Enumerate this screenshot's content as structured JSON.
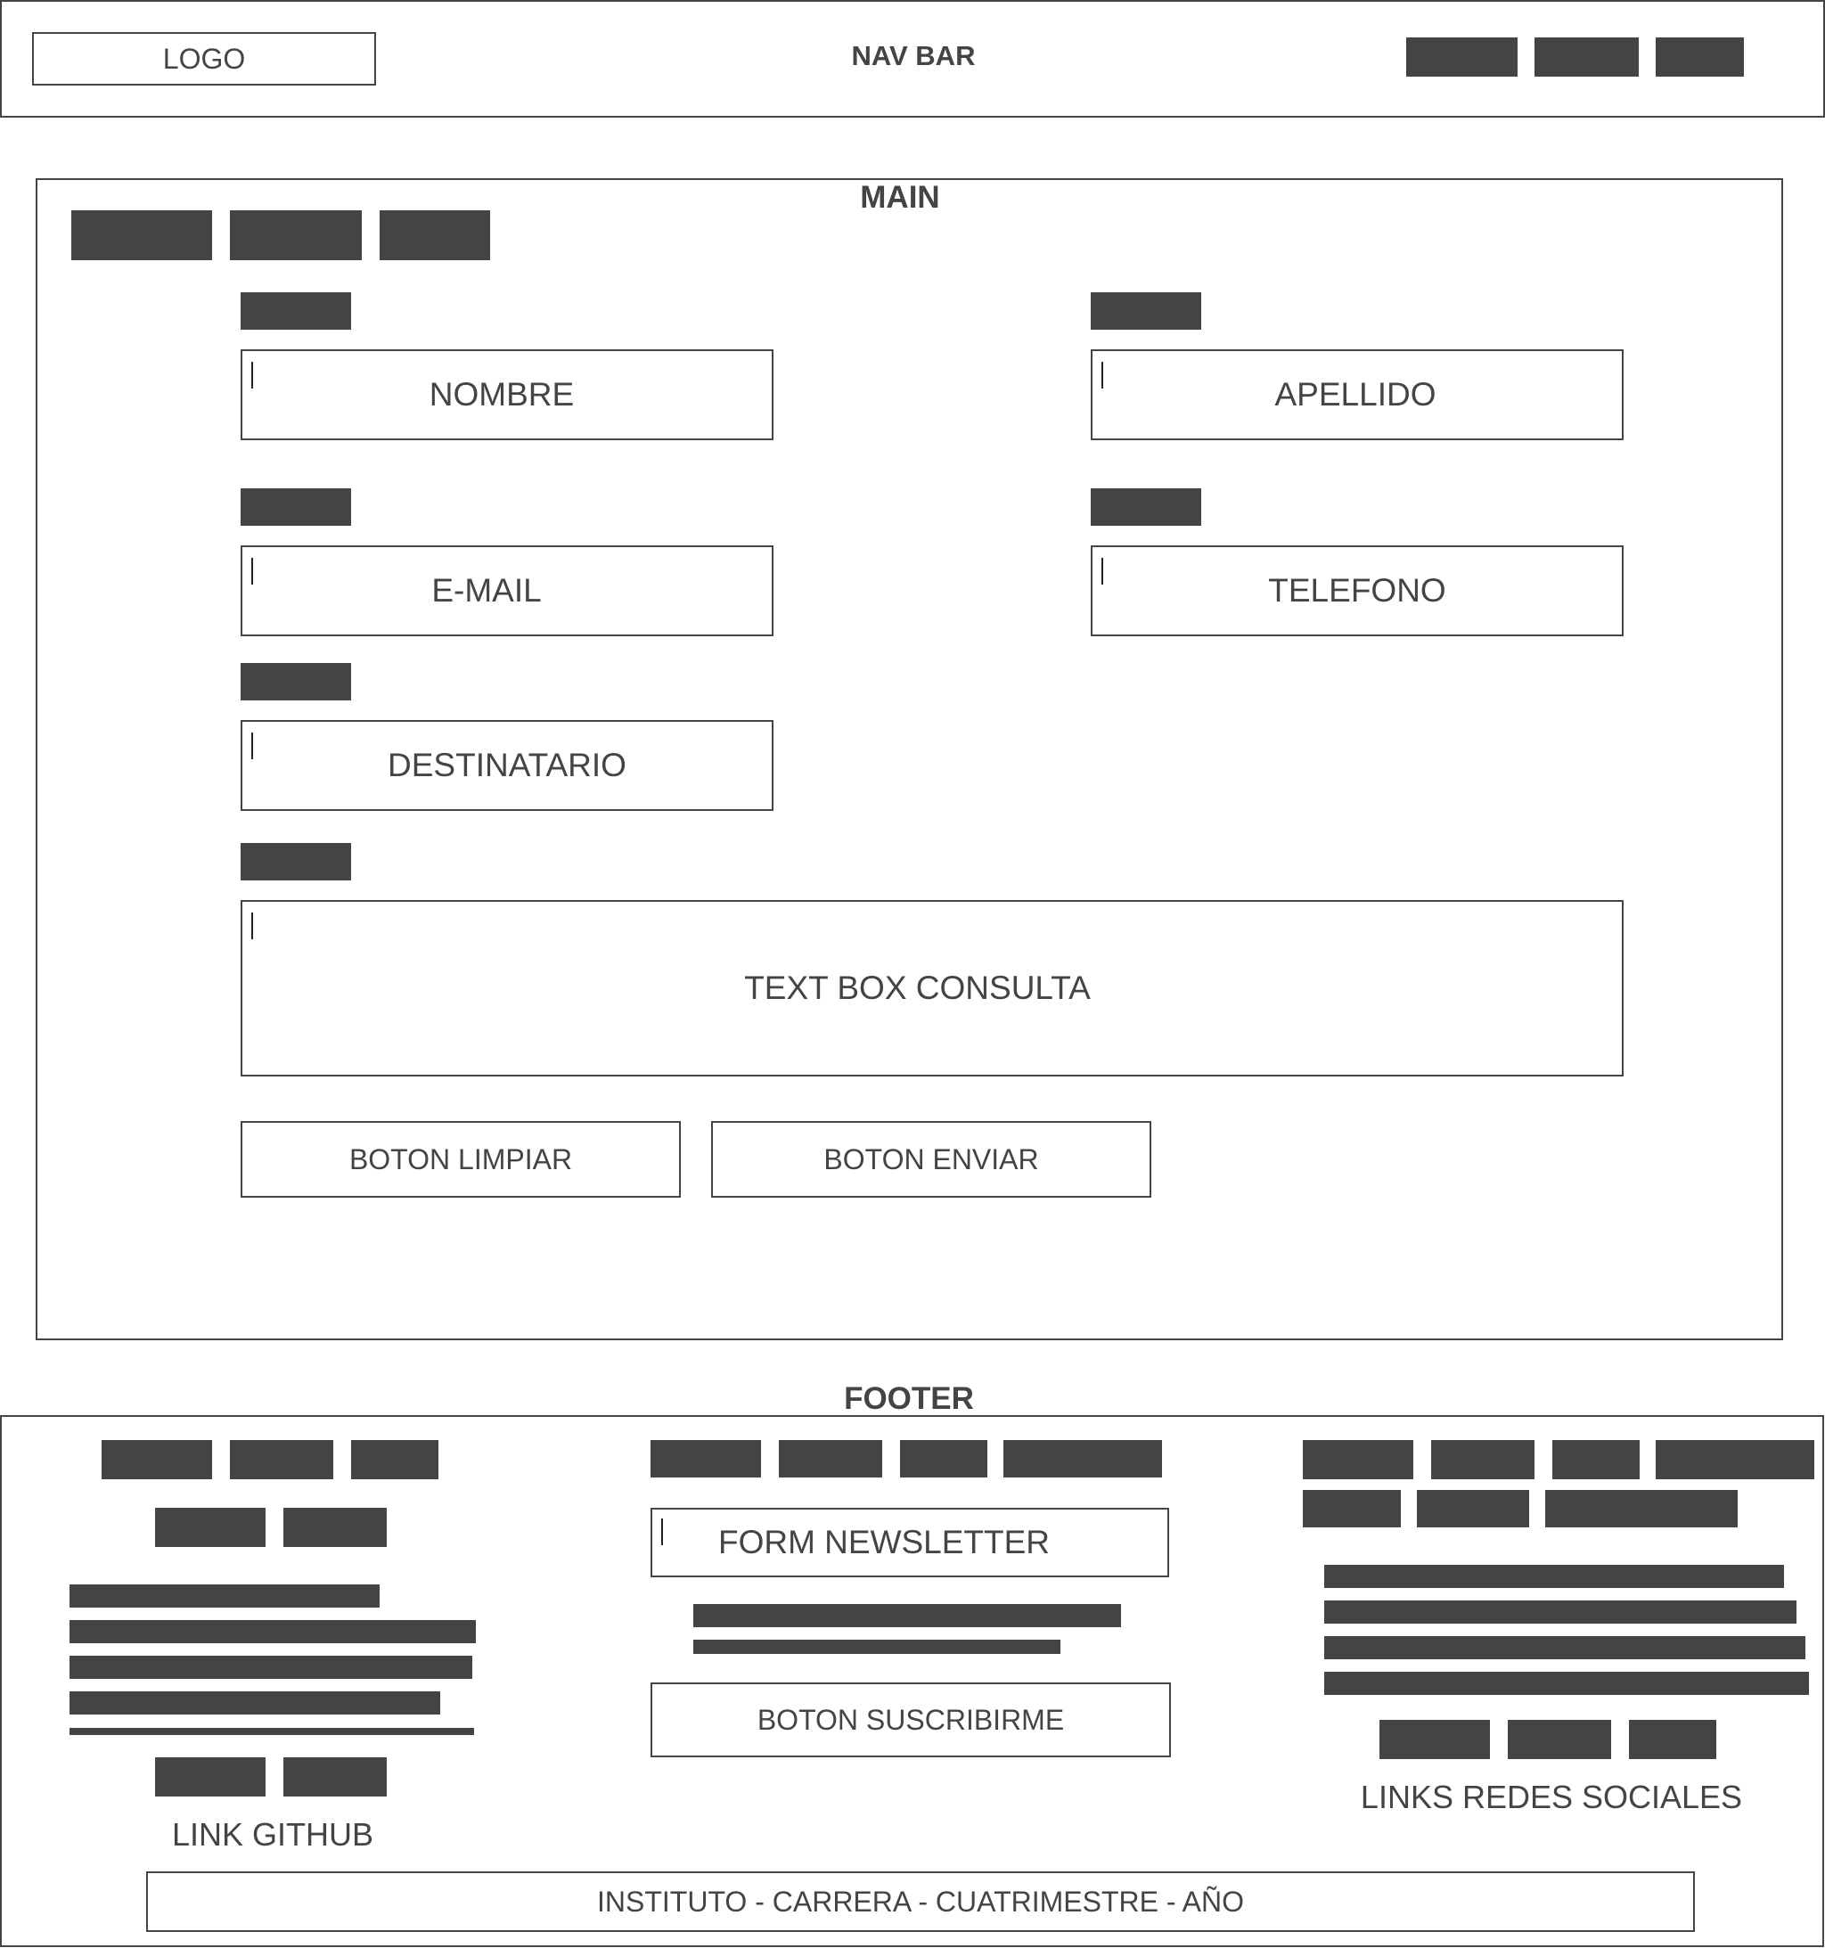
{
  "header": {
    "title": "NAV BAR",
    "logo": "LOGO"
  },
  "main": {
    "title": "MAIN",
    "fields": {
      "nombre": "NOMBRE",
      "apellido": "APELLIDO",
      "email": "E-MAIL",
      "telefono": "TELEFONO",
      "destinatario": "DESTINATARIO",
      "consulta": "TEXT BOX CONSULTA"
    },
    "buttons": {
      "limpiar": "BOTON LIMPIAR",
      "enviar": "BOTON ENVIAR"
    }
  },
  "footer": {
    "title": "FOOTER",
    "github_link": "LINK GITHUB",
    "newsletter_field": "FORM NEWSLETTER",
    "subscribe_button": "BOTON SUSCRIBIRME",
    "social_links": "LINKS REDES SOCIALES",
    "credits": "INSTITUTO - CARRERA - CUATRIMESTRE - AÑO"
  },
  "colors": {
    "ink": "#444444",
    "background": "#ffffff"
  }
}
